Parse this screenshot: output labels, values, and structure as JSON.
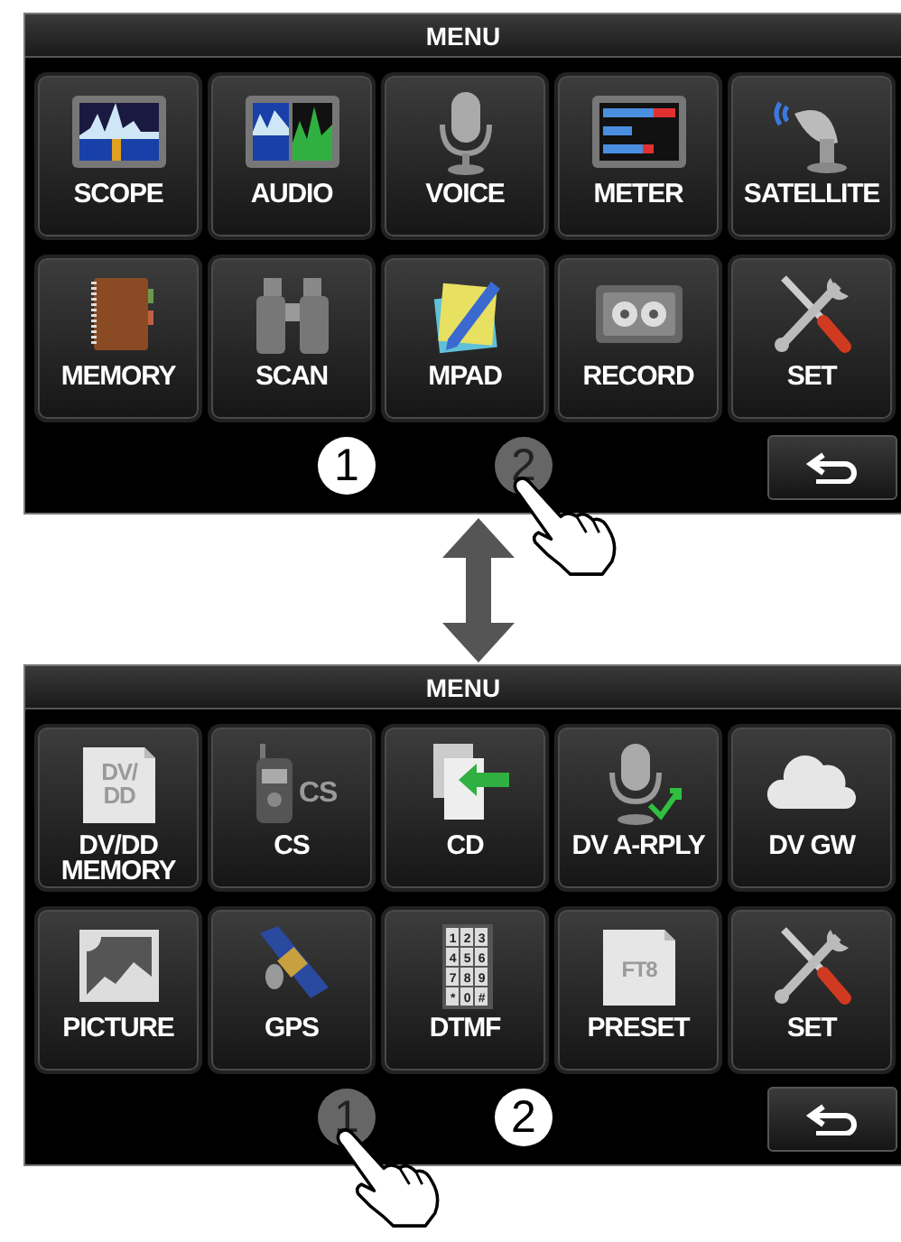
{
  "screens": [
    {
      "title": "MENU",
      "tiles": [
        {
          "label": "SCOPE"
        },
        {
          "label": "AUDIO"
        },
        {
          "label": "VOICE"
        },
        {
          "label": "METER"
        },
        {
          "label": "SATELLITE"
        },
        {
          "label": "MEMORY"
        },
        {
          "label": "SCAN"
        },
        {
          "label": "MPAD"
        },
        {
          "label": "RECORD"
        },
        {
          "label": "SET"
        }
      ],
      "pages": [
        {
          "label": "1",
          "pressed": false
        },
        {
          "label": "2",
          "pressed": true
        }
      ]
    },
    {
      "title": "MENU",
      "tiles": [
        {
          "label": "DV/DD MEMORY",
          "icon_text": [
            "DV/",
            "DD"
          ]
        },
        {
          "label": "CS",
          "icon_text": [
            "CS"
          ]
        },
        {
          "label": "CD"
        },
        {
          "label": "DV A-RPLY"
        },
        {
          "label": "DV GW"
        },
        {
          "label": "PICTURE"
        },
        {
          "label": "GPS"
        },
        {
          "label": "DTMF",
          "icon_text": [
            "1",
            "2",
            "3",
            "4",
            "5",
            "6",
            "7",
            "8",
            "9",
            "*",
            "0",
            "#"
          ]
        },
        {
          "label": "PRESET",
          "icon_text": [
            "FT8"
          ]
        },
        {
          "label": "SET"
        }
      ],
      "pages": [
        {
          "label": "1",
          "pressed": true
        },
        {
          "label": "2",
          "pressed": false
        }
      ]
    }
  ]
}
